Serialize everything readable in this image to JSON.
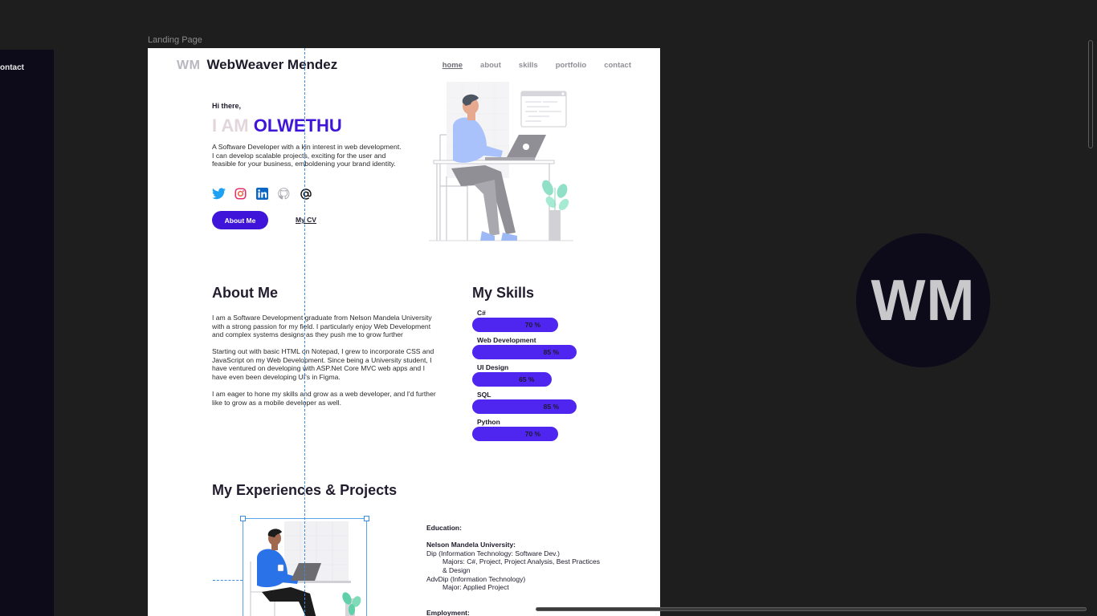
{
  "canvas": {
    "frame_label": "Landing Page",
    "left_strip_text": "ontact"
  },
  "header": {
    "logo_mono": "WM",
    "logo_name": "WebWeaver Mendez",
    "nav": [
      "home",
      "about",
      "skills",
      "portfolio",
      "contact"
    ],
    "active_nav": "home"
  },
  "hero": {
    "greeting": "Hi there,",
    "iam": "I AM",
    "name": "OLWETHU",
    "intro": "A Software Developer with a kin interest in web development. I can develop scalable projects, exciting for the user and feasible for your business, emboldening your brand identity.",
    "socials": [
      "twitter-icon",
      "instagram-icon",
      "linkedin-icon",
      "github-icon",
      "at-sign-icon"
    ],
    "about_button": "About Me",
    "cv_button": "My CV"
  },
  "about": {
    "title": "About Me",
    "paragraphs": [
      "I am a Software Development graduate from Nelson Mandela University with a strong passion for my field. I particularly enjoy Web Development and complex systems designs as they push me to grow further",
      "Starting out with basic HTML on Notepad, I grew to incorporate CSS and JavaScript on my Web Development. Since being a University student, I have ventured on developing with ASP.Net Core MVC web apps and I have even been developing UI's in Figma.",
      "I am eager to hone my skills and grow as a web developer, and I'd further like to grow as a mobile developer as well."
    ]
  },
  "skills": {
    "title": "My Skills",
    "items": [
      {
        "name": "C#",
        "label": "70 %",
        "level": 70
      },
      {
        "name": "Web Development",
        "label": "85 %",
        "level": 85
      },
      {
        "name": "UI Design",
        "label": "65 %",
        "level": 65
      },
      {
        "name": "SQL",
        "label": "85 %",
        "level": 85
      },
      {
        "name": "Python",
        "label": "70 %",
        "level": 70
      }
    ],
    "bar_color": "#4f26f0"
  },
  "experience": {
    "title": "My Experiences & Projects",
    "education_heading": "Education:",
    "university": "Nelson Mandela University:",
    "dip": "Dip (Information Technology:  Software Dev.)",
    "dip_majors": "Majors: C#, Project, Project Analysis, Best Practices & Design",
    "advdip": "AdvDip (Information Technology)",
    "advdip_major": "Major: Applied Project",
    "employment_heading": "Employment:"
  },
  "avatar": {
    "initials": "WM"
  },
  "colors": {
    "accent": "#3f16d9",
    "canvas": "#1e1e1e",
    "dark": "#0d0a1a"
  }
}
